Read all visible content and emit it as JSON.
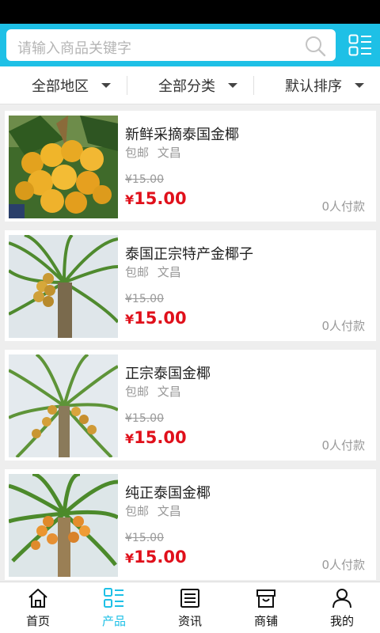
{
  "search": {
    "placeholder": "请输入商品关键字"
  },
  "filters": [
    {
      "label": "全部地区"
    },
    {
      "label": "全部分类"
    },
    {
      "label": "默认排序"
    }
  ],
  "products": [
    {
      "name": "新鲜采摘泰国金椰",
      "tags": [
        "包邮",
        "文昌"
      ],
      "original_price": "¥15.00",
      "currency": "¥",
      "price": "15.00",
      "sales": "0人付款"
    },
    {
      "name": "泰国正宗特产金椰子",
      "tags": [
        "包邮",
        "文昌"
      ],
      "original_price": "¥15.00",
      "currency": "¥",
      "price": "15.00",
      "sales": "0人付款"
    },
    {
      "name": "正宗泰国金椰",
      "tags": [
        "包邮",
        "文昌"
      ],
      "original_price": "¥15.00",
      "currency": "¥",
      "price": "15.00",
      "sales": "0人付款"
    },
    {
      "name": "纯正泰国金椰",
      "tags": [
        "包邮",
        "文昌"
      ],
      "original_price": "¥15.00",
      "currency": "¥",
      "price": "15.00",
      "sales": "0人付款"
    }
  ],
  "tabs": [
    {
      "label": "首页",
      "icon": "home-icon"
    },
    {
      "label": "产品",
      "icon": "product-list-icon",
      "active": true
    },
    {
      "label": "资讯",
      "icon": "news-icon"
    },
    {
      "label": "商铺",
      "icon": "store-icon"
    },
    {
      "label": "我的",
      "icon": "user-icon"
    }
  ],
  "colors": {
    "accent": "#1ec0e6",
    "price": "#e0101b",
    "muted": "#999999"
  }
}
